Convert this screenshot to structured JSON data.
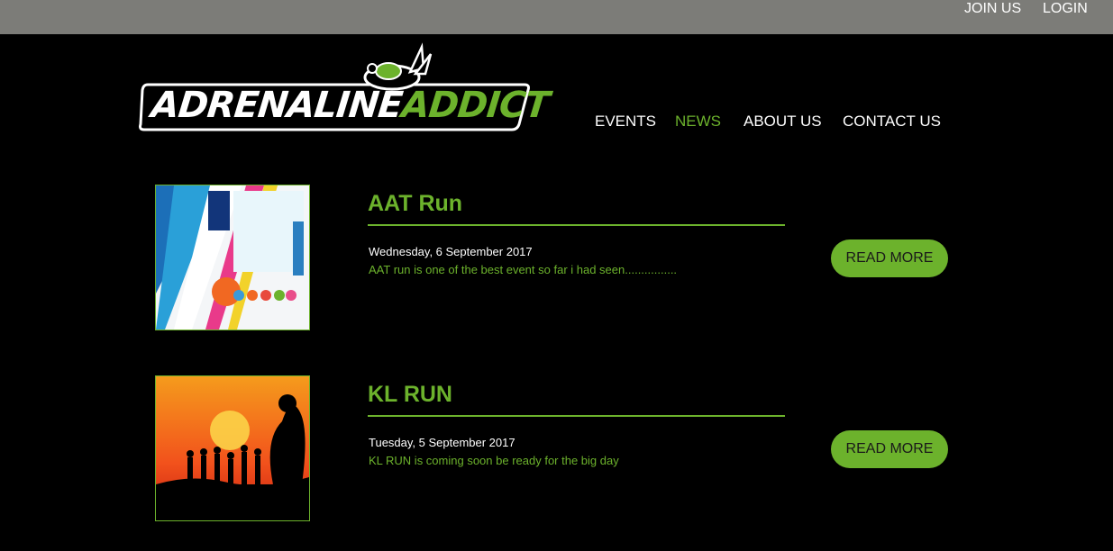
{
  "topbar": {
    "join_label": "JOIN US",
    "login_label": "LOGIN"
  },
  "logo": {
    "word1": "ADRENALINE",
    "word2": "ADDICT",
    "mascot": "turtle-on-rabbit-icon"
  },
  "nav": {
    "items": [
      {
        "label": "EVENTS",
        "active": false
      },
      {
        "label": "NEWS",
        "active": true
      },
      {
        "label": "ABOUT US",
        "active": false
      },
      {
        "label": "CONTACT US",
        "active": false
      }
    ]
  },
  "news": [
    {
      "title": "AAT Run",
      "date": "Wednesday, 6 September 2017",
      "excerpt": "AAT run is one of the best event so far i had seen................",
      "button_label": "READ MORE",
      "thumbnail": "aat-run-poster-image"
    },
    {
      "title": "KL RUN",
      "date": "Tuesday, 5 September 2017",
      "excerpt": "KL RUN is coming soon be ready for the big day",
      "button_label": "READ MORE",
      "thumbnail": "sunset-silhouette-image"
    }
  ],
  "colors": {
    "accent": "#6cb22c",
    "topbar": "#7c7c78",
    "background": "#000000",
    "text": "#ffffff"
  }
}
